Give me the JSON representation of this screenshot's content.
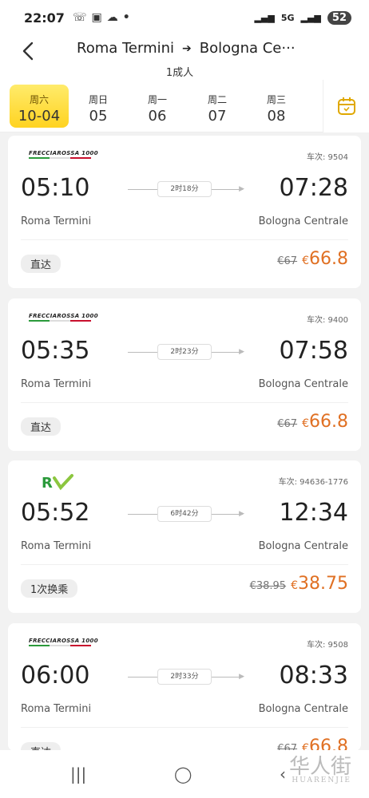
{
  "status": {
    "time": "22:07",
    "network": "5G",
    "battery": "52"
  },
  "header": {
    "from": "Roma Termini",
    "to": "Bologna Ce···",
    "passengers": "1成人"
  },
  "dates": [
    {
      "weekday": "周六",
      "date": "10-04",
      "active": true
    },
    {
      "weekday": "周日",
      "date": "05"
    },
    {
      "weekday": "周一",
      "date": "06"
    },
    {
      "weekday": "周二",
      "date": "07"
    },
    {
      "weekday": "周三",
      "date": "08"
    }
  ],
  "trains": [
    {
      "brand": "FRECCIAROSSA 1000",
      "train_no": "车次: 9504",
      "dep": "05:10",
      "arr": "07:28",
      "duration": "2时18分",
      "from": "Roma Termini",
      "to": "Bologna Centrale",
      "tag": "直达",
      "old_price": "€67",
      "currency": "€",
      "price": "66.8"
    },
    {
      "brand": "FRECCIAROSSA 1000",
      "train_no": "车次: 9400",
      "dep": "05:35",
      "arr": "07:58",
      "duration": "2时23分",
      "from": "Roma Termini",
      "to": "Bologna Centrale",
      "tag": "直达",
      "old_price": "€67",
      "currency": "€",
      "price": "66.8"
    },
    {
      "brand": "RV",
      "train_no": "车次: 94636-1776",
      "dep": "05:52",
      "arr": "12:34",
      "duration": "6时42分",
      "from": "Roma Termini",
      "to": "Bologna Centrale",
      "tag": "1次换乘",
      "old_price": "€38.95",
      "currency": "€",
      "price": "38.75"
    },
    {
      "brand": "FRECCIAROSSA 1000",
      "train_no": "车次: 9508",
      "dep": "06:00",
      "arr": "08:33",
      "duration": "2时33分",
      "from": "Roma Termini",
      "to": "Bologna Centrale",
      "tag": "直达",
      "old_price": "€67",
      "currency": "€",
      "price": "66.8"
    }
  ],
  "watermark": {
    "main": "华人街",
    "sub": "HUARENJIE"
  },
  "colors": {
    "accent": "#ffd321",
    "price": "#e07023"
  }
}
